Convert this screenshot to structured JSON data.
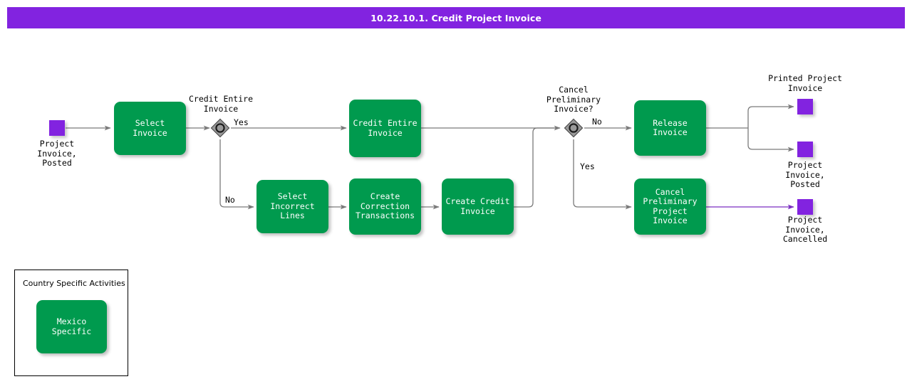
{
  "header": {
    "title": "10.22.10.1. Credit Project Invoice",
    "background_color": "#8223e0",
    "text_color": "#ffffff"
  },
  "theme": {
    "process_fill": "#009a4e",
    "terminator_fill": "#8223e0",
    "decision_fill": "#808080",
    "connector_gray": "#7a7a7a",
    "connector_purple": "#7a2fc0",
    "page_background": "#ffffff"
  },
  "diagram": {
    "type": "flowchart",
    "terminators": [
      {
        "id": "start",
        "label": "Project\nInvoice,\nPosted",
        "label_position": "below"
      },
      {
        "id": "printed-project-invoice",
        "label": "Printed Project\nInvoice",
        "label_position": "above"
      },
      {
        "id": "project-invoice-posted-end",
        "label": "Project\nInvoice,\nPosted",
        "label_position": "below"
      },
      {
        "id": "project-invoice-cancelled",
        "label": "Project\nInvoice,\nCancelled",
        "label_position": "below"
      }
    ],
    "processes": [
      {
        "id": "select-invoice",
        "label": "Select Invoice"
      },
      {
        "id": "credit-entire-invoice",
        "label": "Credit Entire\nInvoice"
      },
      {
        "id": "select-incorrect-lines",
        "label": "Select Incorrect\nLines"
      },
      {
        "id": "create-correction-transactions",
        "label": "Create\nCorrection\nTransactions"
      },
      {
        "id": "create-credit-invoice",
        "label": "Create Credit\nInvoice"
      },
      {
        "id": "release-invoice",
        "label": "Release Invoice"
      },
      {
        "id": "cancel-preliminary-project-invoice",
        "label": "Cancel\nPreliminary\nProject Invoice"
      }
    ],
    "decisions": [
      {
        "id": "credit-entire-invoice-decision",
        "label": "Credit Entire\nInvoice",
        "branches": [
          {
            "label": "Yes",
            "direction": "right"
          },
          {
            "label": "No",
            "direction": "down"
          }
        ]
      },
      {
        "id": "cancel-preliminary-invoice-decision",
        "label": "Cancel\nPreliminary\nInvoice?",
        "branches": [
          {
            "label": "No",
            "direction": "right"
          },
          {
            "label": "Yes",
            "direction": "down"
          }
        ]
      }
    ],
    "legend": {
      "title": "Country Specific Activities",
      "items": [
        {
          "id": "mexico-specific",
          "label": "Mexico Specific"
        }
      ]
    }
  }
}
